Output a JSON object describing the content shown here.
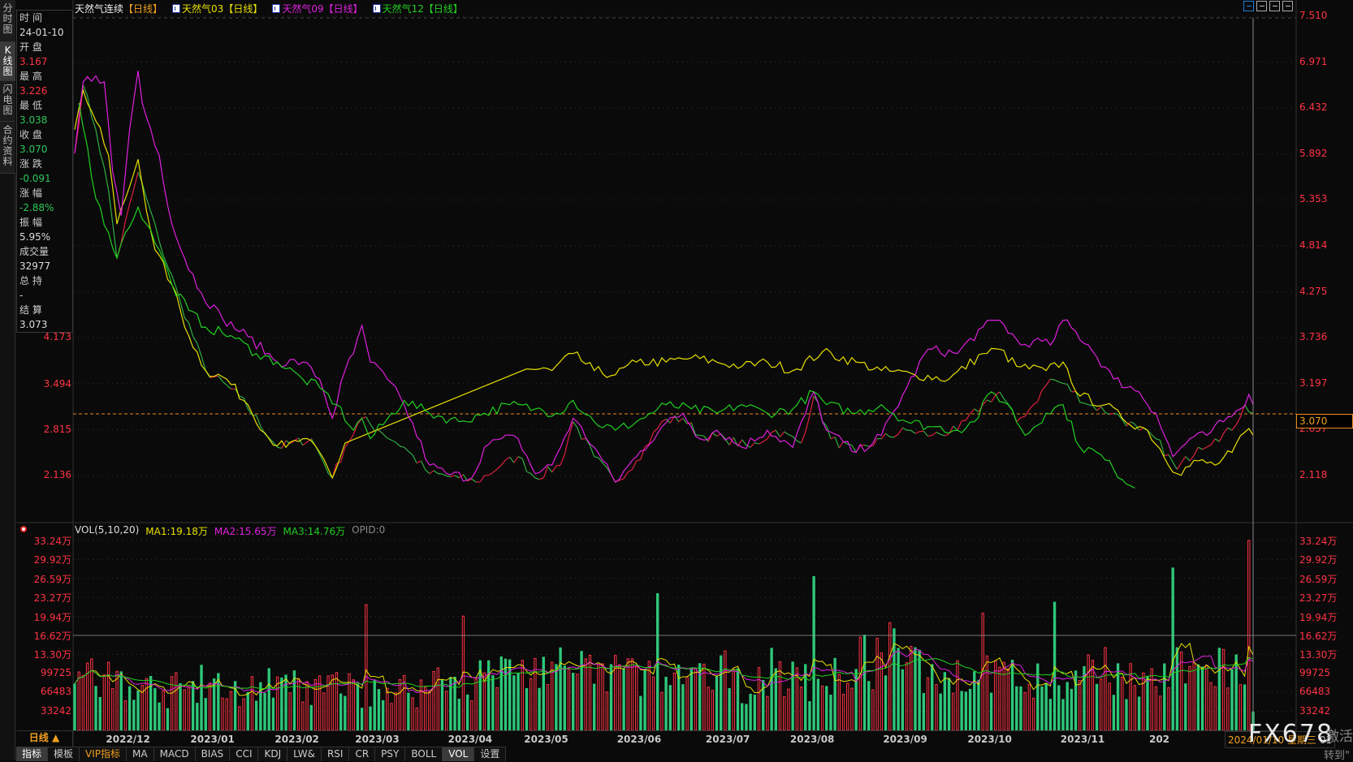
{
  "side_tabs": [
    {
      "label": "分时图"
    },
    {
      "label": "K线图",
      "active": true
    },
    {
      "label": "闪电图"
    },
    {
      "label": "合约资料"
    }
  ],
  "info": {
    "time_label": "时 间",
    "time": "24-01-10",
    "open_label": "开 盘",
    "open": "3.167",
    "high_label": "最 高",
    "high": "3.226",
    "low_label": "最 低",
    "low": "3.038",
    "close_label": "收 盘",
    "close": "3.070",
    "change_label": "涨 跌",
    "change": "-0.091",
    "pct_label": "涨 幅",
    "pct": "-2.88%",
    "amp_label": "振 幅",
    "amp": "5.95%",
    "volume_label": "成交量",
    "volume": "32977",
    "oi_label": "总 持",
    "oi": "-",
    "settle_label": "结 算",
    "settle": "3.073"
  },
  "legend": {
    "main": "天然气连续",
    "main_period": "【日线】",
    "s1": "天然气03",
    "s1_period": "【日线】",
    "s2": "天然气09",
    "s2_period": "【日线】",
    "s3": "天然气12",
    "s3_period": "【日线】"
  },
  "colors": {
    "up": "#ff3344",
    "down": "#2ec77a",
    "s1": "#e8e000",
    "s2": "#e020e0",
    "s3": "#20d020",
    "accent": "#f0a020"
  },
  "right_axis": [
    "7.510",
    "6.971",
    "6.432",
    "5.892",
    "5.353",
    "4.814",
    "4.275",
    "3.736",
    "3.197",
    "2.657",
    "2.118"
  ],
  "left_axis": [
    "4.173",
    "3.494",
    "2.815",
    "2.136"
  ],
  "current_price": "3.070",
  "vol_legend": {
    "name": "VOL(5,10,20)",
    "ma1": "MA1:19.18万",
    "ma2": "MA2:15.65万",
    "ma3": "MA3:14.76万",
    "opid": "OPID:0"
  },
  "vol_axis": [
    "33.24万",
    "29.92万",
    "26.59万",
    "23.27万",
    "19.94万",
    "16.62万",
    "13.30万",
    "99725",
    "66483",
    "33242"
  ],
  "x_ticks": [
    {
      "d": 7,
      "label": "2022/12"
    },
    {
      "d": 27,
      "label": "2023/01"
    },
    {
      "d": 47,
      "label": "2023/02"
    },
    {
      "d": 66,
      "label": "2023/03"
    },
    {
      "d": 88,
      "label": "2023/04"
    },
    {
      "d": 106,
      "label": "2023/05"
    },
    {
      "d": 128,
      "label": "2023/06"
    },
    {
      "d": 149,
      "label": "2023/07"
    },
    {
      "d": 169,
      "label": "2023/08"
    },
    {
      "d": 191,
      "label": "2023/09"
    },
    {
      "d": 211,
      "label": "2023/10"
    },
    {
      "d": 233,
      "label": "2023/11"
    },
    {
      "d": 254,
      "label": "202"
    }
  ],
  "cursor_date": "2024/01/10 星期三",
  "cursor_tail": "01",
  "period_label": "日线 ▲",
  "bottom_tabs": [
    {
      "label": "指标",
      "active": true
    },
    {
      "label": "模板"
    },
    {
      "label": "VIP指标",
      "vip": true
    },
    {
      "label": "MA"
    },
    {
      "label": "MACD"
    },
    {
      "label": "BIAS"
    },
    {
      "label": "CCI"
    },
    {
      "label": "KDJ"
    },
    {
      "label": "LW&"
    },
    {
      "label": "RSI"
    },
    {
      "label": "CR"
    },
    {
      "label": "PSY"
    },
    {
      "label": "BOLL"
    },
    {
      "label": "VOL",
      "active": true
    },
    {
      "label": "设置"
    }
  ],
  "watermark": "FX678",
  "activate_1": "激活",
  "activate_2": "转到\"",
  "chart_data": {
    "type": "line",
    "price_range": [
      2.118,
      7.51
    ],
    "days": 280,
    "series": [
      {
        "name": "天然气连续",
        "points": [
          [
            0,
            5.9
          ],
          [
            2,
            6.7
          ],
          [
            5,
            6.18
          ],
          [
            8,
            5.47
          ],
          [
            10,
            4.67
          ],
          [
            15,
            5.68
          ],
          [
            17,
            5.37
          ],
          [
            20,
            4.87
          ],
          [
            25,
            4.16
          ],
          [
            31,
            3.35
          ],
          [
            39,
            3.05
          ],
          [
            48,
            2.45
          ],
          [
            56,
            2.55
          ],
          [
            61,
            2.09
          ],
          [
            64,
            2.45
          ],
          [
            68,
            2.79
          ],
          [
            72,
            2.65
          ],
          [
            78,
            2.45
          ],
          [
            84,
            2.14
          ],
          [
            91,
            2.09
          ],
          [
            95,
            2.04
          ],
          [
            101,
            2.24
          ],
          [
            105,
            2.34
          ],
          [
            109,
            2.09
          ],
          [
            115,
            2.24
          ],
          [
            118,
            2.75
          ],
          [
            123,
            2.34
          ],
          [
            128,
            2.04
          ],
          [
            133,
            2.29
          ],
          [
            139,
            2.75
          ],
          [
            144,
            2.79
          ],
          [
            148,
            2.59
          ],
          [
            154,
            2.55
          ],
          [
            160,
            2.45
          ],
          [
            166,
            2.65
          ],
          [
            172,
            2.5
          ],
          [
            175,
            3.05
          ],
          [
            179,
            2.55
          ],
          [
            185,
            2.39
          ],
          [
            191,
            2.55
          ],
          [
            197,
            2.65
          ],
          [
            203,
            2.59
          ],
          [
            209,
            2.65
          ],
          [
            215,
            2.95
          ],
          [
            219,
            3.1
          ],
          [
            223,
            2.75
          ],
          [
            227,
            2.95
          ],
          [
            231,
            3.25
          ],
          [
            234,
            3.2
          ],
          [
            240,
            2.95
          ],
          [
            246,
            2.85
          ],
          [
            252,
            2.65
          ],
          [
            256,
            2.55
          ],
          [
            261,
            2.19
          ],
          [
            266,
            2.45
          ],
          [
            270,
            2.55
          ],
          [
            274,
            2.65
          ],
          [
            277,
            2.95
          ],
          [
            279,
            2.85
          ]
        ]
      },
      {
        "name": "天然气03",
        "points": [
          [
            0,
            6.18
          ],
          [
            2,
            6.64
          ],
          [
            5,
            6.28
          ],
          [
            8,
            5.88
          ],
          [
            10,
            5.07
          ],
          [
            12,
            5.37
          ],
          [
            15,
            5.83
          ],
          [
            16,
            5.53
          ],
          [
            19,
            4.77
          ],
          [
            23,
            4.36
          ],
          [
            27,
            3.76
          ],
          [
            31,
            3.35
          ],
          [
            36,
            3.25
          ],
          [
            41,
            2.95
          ],
          [
            46,
            2.55
          ],
          [
            50,
            2.45
          ],
          [
            54,
            2.55
          ],
          [
            58,
            2.39
          ],
          [
            61,
            2.09
          ],
          [
            64,
            2.5
          ],
          [
            107,
            3.37
          ],
          [
            113,
            3.35
          ],
          [
            118,
            3.55
          ],
          [
            123,
            3.35
          ],
          [
            128,
            3.3
          ],
          [
            133,
            3.45
          ],
          [
            140,
            3.45
          ],
          [
            146,
            3.5
          ],
          [
            152,
            3.45
          ],
          [
            158,
            3.4
          ],
          [
            164,
            3.45
          ],
          [
            170,
            3.35
          ],
          [
            177,
            3.57
          ],
          [
            185,
            3.45
          ],
          [
            191,
            3.35
          ],
          [
            199,
            3.3
          ],
          [
            207,
            3.25
          ],
          [
            215,
            3.55
          ],
          [
            219,
            3.6
          ],
          [
            223,
            3.4
          ],
          [
            230,
            3.35
          ],
          [
            234,
            3.45
          ],
          [
            238,
            3.05
          ],
          [
            244,
            2.95
          ],
          [
            248,
            2.79
          ],
          [
            254,
            2.65
          ],
          [
            261,
            2.14
          ],
          [
            266,
            2.29
          ],
          [
            270,
            2.24
          ],
          [
            274,
            2.39
          ],
          [
            278,
            2.67
          ],
          [
            279,
            2.59
          ]
        ]
      },
      {
        "name": "天然气09",
        "points": [
          [
            0,
            5.9
          ],
          [
            2,
            6.74
          ],
          [
            5,
            6.81
          ],
          [
            7,
            6.74
          ],
          [
            9,
            5.68
          ],
          [
            11,
            5.17
          ],
          [
            13,
            6.18
          ],
          [
            15,
            6.87
          ],
          [
            16,
            6.49
          ],
          [
            20,
            5.88
          ],
          [
            23,
            5.07
          ],
          [
            26,
            4.67
          ],
          [
            30,
            4.26
          ],
          [
            35,
            3.96
          ],
          [
            41,
            3.75
          ],
          [
            48,
            3.45
          ],
          [
            54,
            3.45
          ],
          [
            58,
            3.25
          ],
          [
            61,
            2.79
          ],
          [
            64,
            3.35
          ],
          [
            66,
            3.55
          ],
          [
            68,
            3.88
          ],
          [
            70,
            3.45
          ],
          [
            74,
            3.25
          ],
          [
            78,
            2.95
          ],
          [
            84,
            2.24
          ],
          [
            88,
            2.14
          ],
          [
            94,
            2.09
          ],
          [
            97,
            2.45
          ],
          [
            101,
            2.55
          ],
          [
            105,
            2.55
          ],
          [
            109,
            2.14
          ],
          [
            113,
            2.24
          ],
          [
            118,
            2.79
          ],
          [
            123,
            2.45
          ],
          [
            128,
            2.04
          ],
          [
            133,
            2.34
          ],
          [
            139,
            2.69
          ],
          [
            144,
            2.85
          ],
          [
            148,
            2.55
          ],
          [
            152,
            2.65
          ],
          [
            158,
            2.45
          ],
          [
            164,
            2.65
          ],
          [
            170,
            2.45
          ],
          [
            175,
            3.1
          ],
          [
            178,
            2.65
          ],
          [
            185,
            2.39
          ],
          [
            191,
            2.59
          ],
          [
            197,
            3.15
          ],
          [
            202,
            3.6
          ],
          [
            209,
            3.55
          ],
          [
            215,
            3.86
          ],
          [
            219,
            3.94
          ],
          [
            224,
            3.65
          ],
          [
            227,
            3.7
          ],
          [
            231,
            3.65
          ],
          [
            234,
            3.94
          ],
          [
            240,
            3.65
          ],
          [
            246,
            3.25
          ],
          [
            252,
            3.1
          ],
          [
            256,
            2.85
          ],
          [
            260,
            2.34
          ],
          [
            264,
            2.55
          ],
          [
            268,
            2.59
          ],
          [
            272,
            2.75
          ],
          [
            276,
            2.9
          ],
          [
            278,
            3.07
          ],
          [
            279,
            2.95
          ]
        ]
      },
      {
        "name": "天然气12",
        "points": [
          [
            1,
            6.49
          ],
          [
            3,
            5.98
          ],
          [
            5,
            5.37
          ],
          [
            8,
            4.97
          ],
          [
            10,
            4.67
          ],
          [
            12,
            4.97
          ],
          [
            15,
            5.27
          ],
          [
            17,
            5.07
          ],
          [
            20,
            4.77
          ],
          [
            23,
            4.36
          ],
          [
            27,
            4.06
          ],
          [
            31,
            3.86
          ],
          [
            37,
            3.76
          ],
          [
            43,
            3.55
          ],
          [
            48,
            3.45
          ],
          [
            54,
            3.25
          ],
          [
            58,
            3.15
          ],
          [
            62,
            2.95
          ],
          [
            66,
            2.65
          ],
          [
            68,
            2.79
          ],
          [
            70,
            2.55
          ],
          [
            78,
            3.0
          ],
          [
            84,
            2.85
          ],
          [
            91,
            2.75
          ],
          [
            97,
            2.85
          ],
          [
            103,
            2.95
          ],
          [
            109,
            2.9
          ],
          [
            114,
            2.85
          ],
          [
            118,
            3.0
          ],
          [
            123,
            2.75
          ],
          [
            128,
            2.65
          ],
          [
            133,
            2.75
          ],
          [
            140,
            2.95
          ],
          [
            146,
            2.9
          ],
          [
            152,
            2.85
          ],
          [
            158,
            2.95
          ],
          [
            164,
            2.85
          ],
          [
            170,
            2.9
          ],
          [
            175,
            3.1
          ],
          [
            178,
            2.95
          ],
          [
            185,
            2.85
          ],
          [
            191,
            2.95
          ],
          [
            197,
            2.75
          ],
          [
            203,
            2.69
          ],
          [
            209,
            2.65
          ],
          [
            213,
            2.75
          ],
          [
            217,
            3.1
          ],
          [
            221,
            2.95
          ],
          [
            225,
            2.59
          ],
          [
            230,
            2.85
          ],
          [
            234,
            2.95
          ],
          [
            238,
            2.45
          ],
          [
            242,
            2.39
          ],
          [
            246,
            2.19
          ],
          [
            251,
            1.97
          ]
        ]
      }
    ],
    "volume_max": 332400,
    "volume_spikes": [
      [
        69,
        220000
      ],
      [
        92,
        200000
      ],
      [
        138,
        240000
      ],
      [
        175,
        270000
      ],
      [
        215,
        205000
      ],
      [
        232,
        225000
      ],
      [
        260,
        285000
      ],
      [
        278,
        332400
      ],
      [
        279,
        32977
      ]
    ]
  }
}
